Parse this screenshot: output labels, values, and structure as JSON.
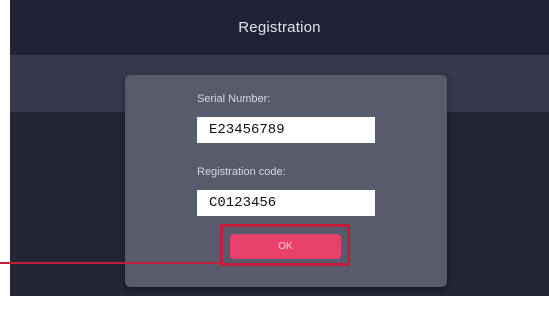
{
  "header": {
    "title": "Registration"
  },
  "dialog": {
    "serial": {
      "label": "Serial Number:",
      "value": "E23456789"
    },
    "registration": {
      "label": "Registration code:",
      "value": "C0123456"
    },
    "ok_button": {
      "label": "OK"
    }
  },
  "annotation": {
    "highlight_color": "#c21d3a"
  },
  "colors": {
    "accent": "#e8416a",
    "title_bar": "#202335",
    "sub_bar": "#373a4d",
    "background": "#232637",
    "dialog": "#585b6b"
  }
}
